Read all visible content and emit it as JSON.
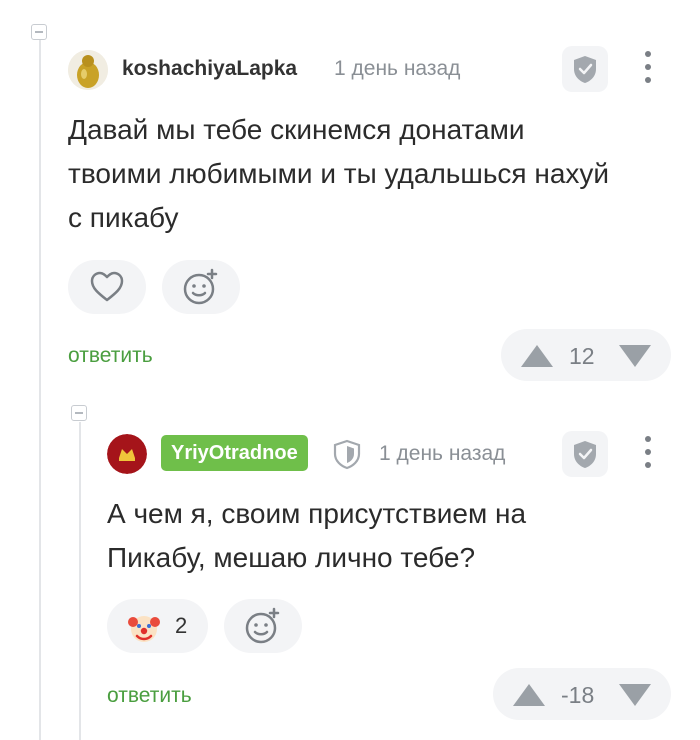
{
  "comments": [
    {
      "username": "koshachiyaLapka",
      "time": "1 день назад",
      "text": "Давай мы тебе скинемся донатами твоими любимыми и ты удальшься нахуй с пикабу",
      "reply_label": "ответить",
      "rating": "12"
    },
    {
      "username": "YriyOtradnoe",
      "time": "1 день назад",
      "text": "А чем я, своим присутствием на Пикабу, мешаю лично тебе?",
      "reaction_count": "2",
      "reply_label": "ответить",
      "rating": "-18"
    }
  ],
  "colors": {
    "reply_link": "#4a9e3f",
    "badge": "#6fbf4a",
    "icon_gray": "#9aa0a6"
  },
  "icons": [
    "shield-icon",
    "kebab-menu-icon",
    "heart-icon",
    "add-reaction-icon",
    "clown-emoji-icon",
    "upvote-icon",
    "downvote-icon",
    "verified-shield-icon"
  ]
}
